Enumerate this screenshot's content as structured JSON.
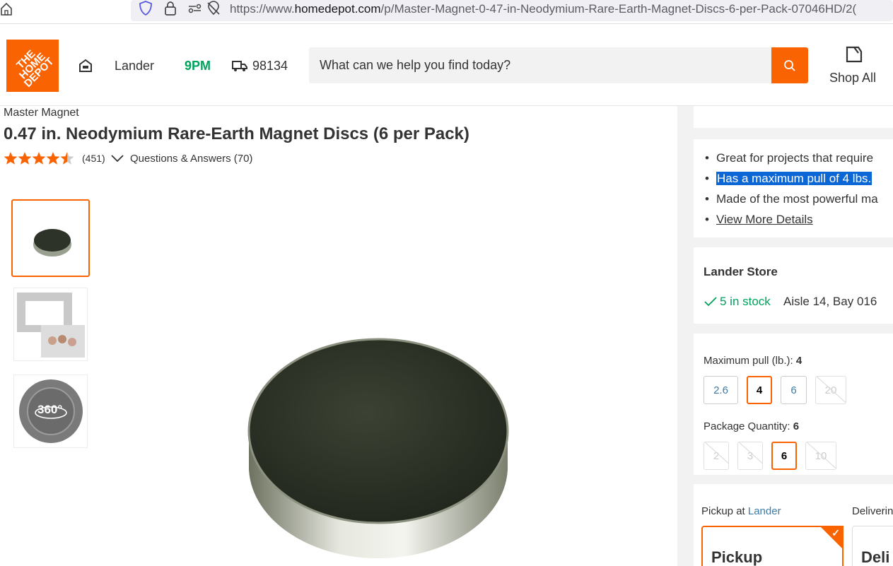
{
  "browser": {
    "url_prefix": "https://www.",
    "url_domain": "homedepot.com",
    "url_path": "/p/Master-Magnet-0-47-in-Neodymium-Rare-Earth-Magnet-Discs-6-per-Pack-07046HD/2("
  },
  "header": {
    "logo_text": "THE HOME DEPOT",
    "store_name": "Lander",
    "store_hours": "9PM",
    "zip": "98134",
    "search_placeholder": "What can we help you find today?",
    "shop_all": "Shop All",
    "brand_color": "#f96302"
  },
  "product": {
    "brand": "Master Magnet",
    "title": "0.47 in. Neodymium Rare-Earth Magnet Discs (6 per Pack)",
    "rating": 4.5,
    "rating_count": "(451)",
    "qa_link": "Questions & Answers (70)",
    "thumbnails": [
      "magnet-disc",
      "photo-frame",
      "360-view"
    ],
    "thumb_360_label": "360°"
  },
  "highlights": {
    "bullets": [
      "Great for projects that require",
      "Has a maximum pull of 4 lbs.",
      "Made of the most powerful ma"
    ],
    "view_more": "View More Details"
  },
  "store": {
    "title": "Lander Store",
    "stock": "5 in stock",
    "aisle": "Aisle 14, Bay 016",
    "stock_color": "#00a35c"
  },
  "options": {
    "pull_label": "Maximum pull (lb.):",
    "pull_value": "4",
    "pull_options": [
      "2.6",
      "4",
      "6",
      "20"
    ],
    "qty_label": "Package Quantity:",
    "qty_value": "6",
    "qty_options": [
      "2",
      "3",
      "6",
      "10"
    ]
  },
  "fulfillment": {
    "pickup_at": "Pickup at",
    "pickup_store": "Lander",
    "delivering": "Deliverin",
    "pickup_label": "Pickup",
    "delivery_label": "Deli"
  }
}
